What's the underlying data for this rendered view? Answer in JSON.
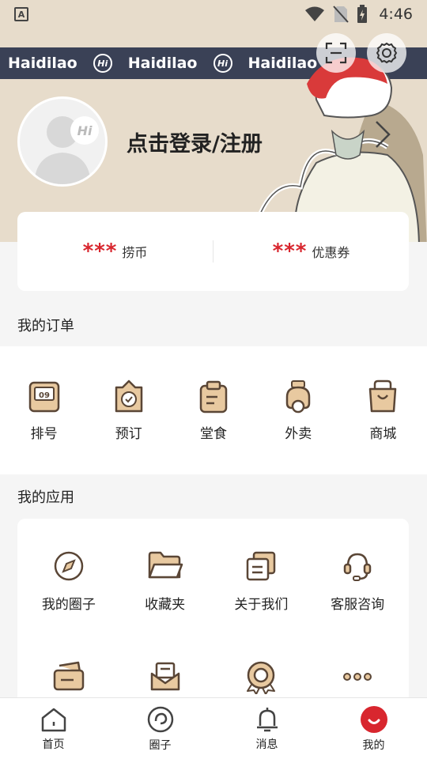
{
  "status_bar": {
    "time": "4:46",
    "app_icon_letter": "A"
  },
  "brand_strip": {
    "items": [
      "Haidilao",
      "Haidilao",
      "Haidilao"
    ],
    "logo_text": "Hi"
  },
  "profile": {
    "login_text": "点击登录/注册",
    "avatar_badge": "Hi"
  },
  "coins": [
    {
      "value": "***",
      "label": "捞币"
    },
    {
      "value": "***",
      "label": "优惠券"
    }
  ],
  "orders": {
    "title": "我的订单",
    "items": [
      {
        "label": "排号",
        "icon": "queue-number-icon",
        "badge": "09"
      },
      {
        "label": "预订",
        "icon": "reservation-icon"
      },
      {
        "label": "堂食",
        "icon": "dine-in-icon"
      },
      {
        "label": "外卖",
        "icon": "delivery-icon"
      },
      {
        "label": "商城",
        "icon": "shop-bag-icon"
      }
    ]
  },
  "apps": {
    "title": "我的应用",
    "items": [
      {
        "label": "我的圈子",
        "icon": "compass-icon"
      },
      {
        "label": "收藏夹",
        "icon": "folder-icon"
      },
      {
        "label": "关于我们",
        "icon": "document-icon"
      },
      {
        "label": "客服咨询",
        "icon": "headset-icon"
      },
      {
        "label": "",
        "icon": "card-icon"
      },
      {
        "label": "",
        "icon": "mail-icon"
      },
      {
        "label": "",
        "icon": "medal-icon"
      },
      {
        "label": "",
        "icon": "more-icon"
      }
    ]
  },
  "nav": [
    {
      "label": "首页",
      "icon": "home-icon"
    },
    {
      "label": "圈子",
      "icon": "circle-icon"
    },
    {
      "label": "消息",
      "icon": "bell-icon"
    },
    {
      "label": "我的",
      "icon": "profile-face-icon"
    }
  ],
  "colors": {
    "accent": "#d8262e",
    "header_bg": "#e7dccb",
    "brand_strip": "#3a4156",
    "icon_fill": "#e8c9a0",
    "icon_stroke": "#5a4636"
  }
}
